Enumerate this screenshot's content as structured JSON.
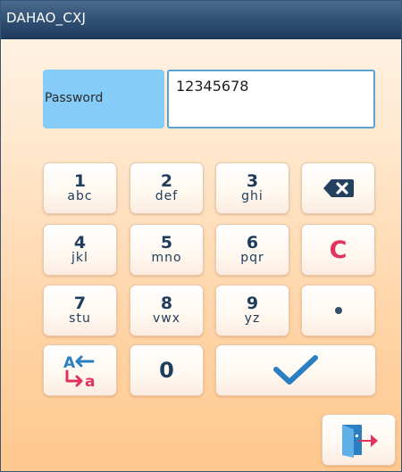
{
  "window": {
    "title": "DAHAO_CXJ"
  },
  "password": {
    "label": "Password",
    "value": "12345678"
  },
  "keypad": {
    "keys": [
      {
        "num": "1",
        "letters": "abc"
      },
      {
        "num": "2",
        "letters": "def"
      },
      {
        "num": "3",
        "letters": "ghi"
      },
      {
        "num": "4",
        "letters": "jkl"
      },
      {
        "num": "5",
        "letters": "mno"
      },
      {
        "num": "6",
        "letters": "pqr"
      },
      {
        "num": "7",
        "letters": "stu"
      },
      {
        "num": "8",
        "letters": "vwx"
      },
      {
        "num": "9",
        "letters": "yz"
      }
    ],
    "zero": "0",
    "clear": "C",
    "icons": {
      "backspace": "backspace-icon",
      "dot": "dot-icon",
      "case_toggle": "case-toggle-icon",
      "confirm": "checkmark-icon",
      "exit": "exit-door-icon"
    }
  },
  "colors": {
    "title_bar": "#2f4f72",
    "label_bg": "#86ccf9",
    "key_text": "#1e3c5c",
    "clear_red": "#e2335e",
    "confirm_blue": "#2a7fc2"
  }
}
